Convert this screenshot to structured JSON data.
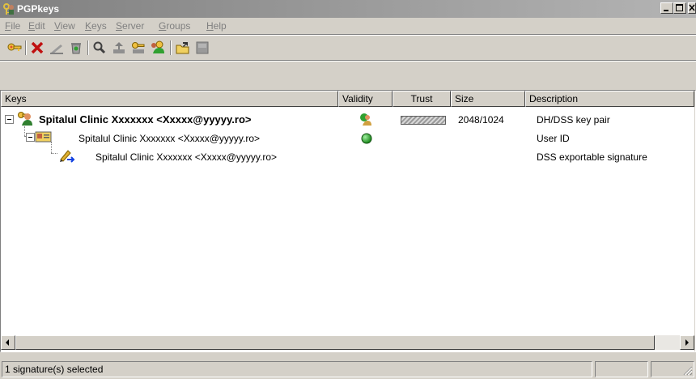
{
  "window": {
    "title": "PGPkeys"
  },
  "menu": [
    {
      "label": "File",
      "ul": "F",
      "rest": "ile"
    },
    {
      "label": "Edit",
      "ul": "E",
      "rest": "dit"
    },
    {
      "label": "View",
      "ul": "V",
      "rest": "iew"
    },
    {
      "label": "Keys",
      "ul": "K",
      "rest": "eys"
    },
    {
      "label": "Server",
      "ul": "S",
      "rest": "erver"
    },
    {
      "label": "Groups",
      "ul": "G",
      "rest": "roups"
    },
    {
      "label": "Help",
      "ul": "H",
      "rest": "elp"
    }
  ],
  "toolbar": {
    "icons": [
      "new-key-icon",
      "delete-icon",
      "sign-icon",
      "revoke-icon",
      "search-icon",
      "send-to-server-icon",
      "update-from-server-icon",
      "key-properties-icon",
      "import-icon",
      "export-icon"
    ]
  },
  "columns": {
    "keys": "Keys",
    "validity": "Validity",
    "trust": "Trust",
    "size": "Size",
    "description": "Description"
  },
  "rows": [
    {
      "name": "Spitalul Clinic Xxxxxxx <Xxxxx@yyyyy.ro>",
      "size": "2048/1024",
      "description": "DH/DSS key pair"
    },
    {
      "name": "Spitalul Clinic Xxxxxxx <Xxxxx@yyyyy.ro>",
      "size": "",
      "description": "User ID"
    },
    {
      "name": "Spitalul Clinic Xxxxxxx <Xxxxx@yyyyy.ro>",
      "size": "",
      "description": "DSS exportable signature"
    }
  ],
  "status": {
    "text": "1 signature(s) selected"
  },
  "colors": {
    "titlebar_start": "#808080",
    "titlebar_end": "#b4b4b4",
    "validity_green": "#1fa81f",
    "face": "#d4d0c8"
  }
}
